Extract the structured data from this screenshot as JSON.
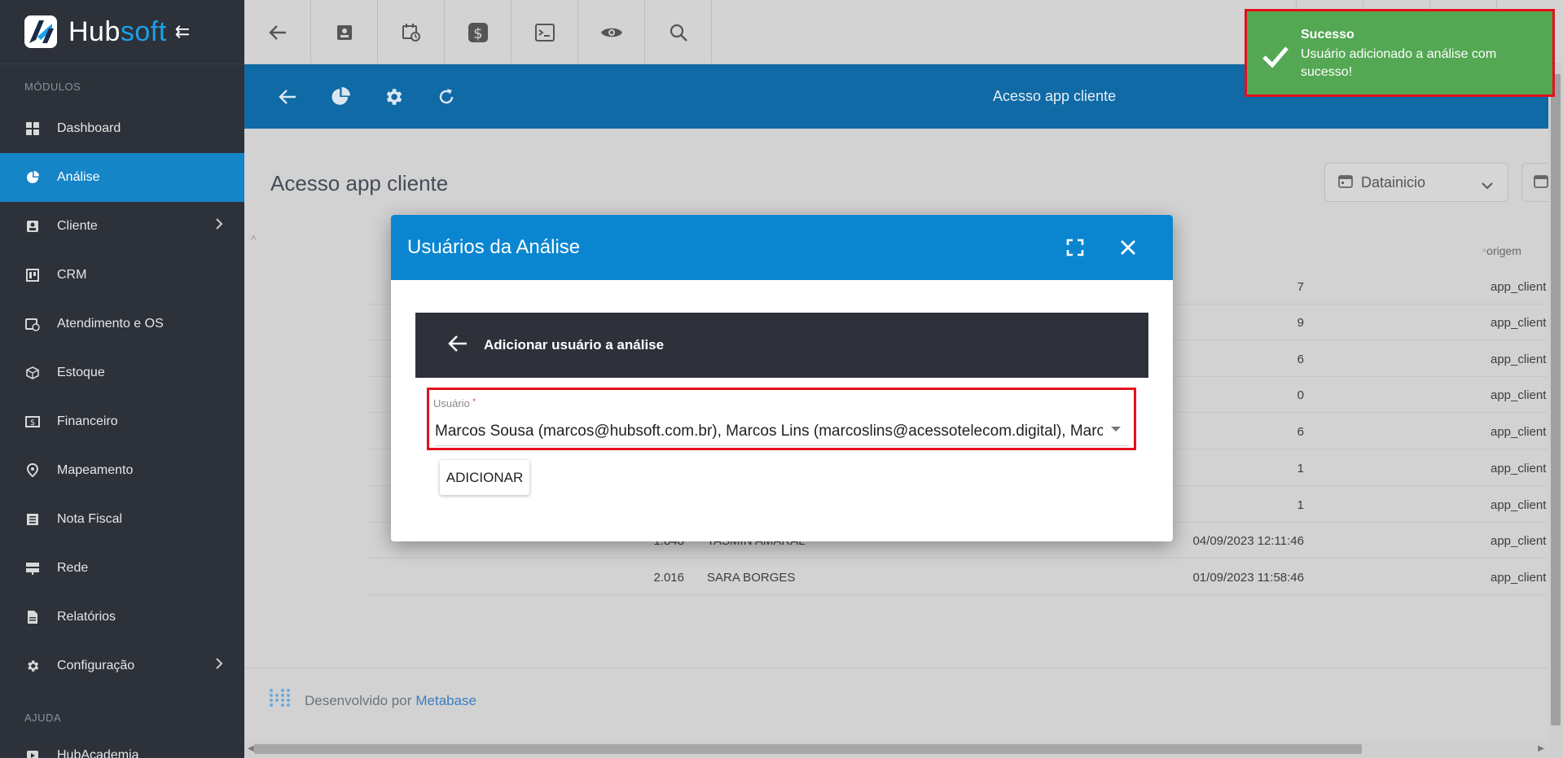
{
  "brand": {
    "name_a": "Hub",
    "name_b": "soft",
    "collapse_icon": "collapse-menu-icon"
  },
  "sidebar": {
    "section_modules": "MÓDULOS",
    "items": [
      {
        "label": "Dashboard",
        "icon": "dashboard-icon"
      },
      {
        "label": "Análise",
        "icon": "pie-chart-icon",
        "active": true
      },
      {
        "label": "Cliente",
        "icon": "client-card-icon",
        "has_children": true
      },
      {
        "label": "CRM",
        "icon": "crm-board-icon"
      },
      {
        "label": "Atendimento e OS",
        "icon": "calendar-clock-icon"
      },
      {
        "label": "Estoque",
        "icon": "box-icon"
      },
      {
        "label": "Financeiro",
        "icon": "money-icon"
      },
      {
        "label": "Mapeamento",
        "icon": "map-pin-icon"
      },
      {
        "label": "Nota Fiscal",
        "icon": "invoice-icon"
      },
      {
        "label": "Rede",
        "icon": "server-icon"
      },
      {
        "label": "Relatórios",
        "icon": "report-icon"
      },
      {
        "label": "Configuração",
        "icon": "gear-icon",
        "has_children": true
      }
    ],
    "section_help": "AJUDA",
    "help_items": [
      {
        "label": "HubAcademia",
        "icon": "video-icon"
      }
    ]
  },
  "topbar": {
    "buttons": [
      "back-arrow-icon",
      "client-card-icon",
      "calendar-clock-icon",
      "dollar-icon",
      "terminal-icon",
      "eye-icon",
      "search-icon"
    ]
  },
  "content_header": {
    "icons": [
      "back-arrow-icon",
      "pie-chart-icon",
      "gear-icon",
      "refresh-icon"
    ],
    "title": "Acesso app cliente"
  },
  "dashboard": {
    "title": "Acesso app cliente",
    "filter_date_label": "Datainicio",
    "col_origin": "origem",
    "rows": [
      {
        "id": "",
        "name": "",
        "date": "7",
        "origin": "app_client"
      },
      {
        "id": "",
        "name": "",
        "date": "9",
        "origin": "app_client"
      },
      {
        "id": "",
        "name": "",
        "date": "6",
        "origin": "app_client"
      },
      {
        "id": "",
        "name": "",
        "date": "0",
        "origin": "app_client"
      },
      {
        "id": "",
        "name": "",
        "date": "6",
        "origin": "app_client"
      },
      {
        "id": "",
        "name": "",
        "date": "1",
        "origin": "app_client"
      },
      {
        "id": "",
        "name": "",
        "date": "1",
        "origin": "app_client"
      },
      {
        "id": "1.848",
        "name": "TASMIN AMARAL",
        "date": "04/09/2023 12:11:46",
        "origin": "app_client"
      },
      {
        "id": "2.016",
        "name": "SARA BORGES",
        "date": "01/09/2023 11:58:46",
        "origin": "app_client"
      }
    ],
    "footer_text": "Desenvolvido por",
    "footer_link": "Metabase"
  },
  "modal": {
    "title": "Usuários da Análise",
    "subheader": "Adicionar usuário a análise",
    "field_label": "Usuário",
    "field_required_mark": "*",
    "field_value": "Marcos Sousa (marcos@hubsoft.com.br), Marcos Lins (marcoslins@acessotelecom.digital), Marcos",
    "add_button": "ADICIONAR"
  },
  "toast": {
    "title": "Sucesso",
    "message": "Usuário adicionado a análise com sucesso!",
    "color": "#54a854"
  }
}
